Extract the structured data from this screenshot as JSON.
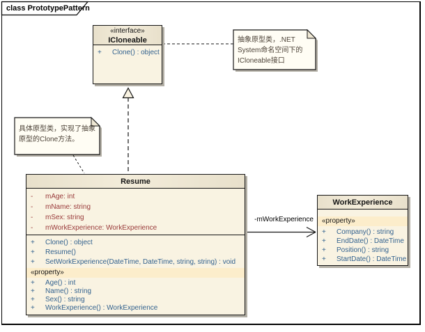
{
  "diagram": {
    "tab_label": "class PrototypePattern"
  },
  "classes": {
    "icloneable": {
      "stereotype": "«interface»",
      "name": "ICloneable",
      "operations": [
        {
          "vis": "+",
          "text": "Clone() : object"
        }
      ]
    },
    "resume": {
      "name": "Resume",
      "attributes": [
        {
          "vis": "-",
          "text": "mAge: int"
        },
        {
          "vis": "-",
          "text": "mName: string"
        },
        {
          "vis": "-",
          "text": "mSex: string"
        },
        {
          "vis": "-",
          "text": "mWorkExperience: WorkExperience"
        }
      ],
      "operations": [
        {
          "vis": "+",
          "text": "Clone() : object"
        },
        {
          "vis": "+",
          "text": "Resume()"
        },
        {
          "vis": "+",
          "text": "SetWorkExperience(DateTime, DateTime, string, string) : void"
        }
      ],
      "property_group_label": "«property»",
      "properties": [
        {
          "vis": "+",
          "text": "Age() : int"
        },
        {
          "vis": "+",
          "text": "Name() : string"
        },
        {
          "vis": "+",
          "text": "Sex() : string"
        },
        {
          "vis": "+",
          "text": "WorkExperience() : WorkExperience"
        }
      ]
    },
    "workexperience": {
      "name": "WorkExperience",
      "property_group_label": "«property»",
      "properties": [
        {
          "vis": "+",
          "text": "Company() : string"
        },
        {
          "vis": "+",
          "text": "EndDate() : DateTime"
        },
        {
          "vis": "+",
          "text": "Position() : string"
        },
        {
          "vis": "+",
          "text": "StartDate() : DateTime"
        }
      ]
    }
  },
  "notes": {
    "abstract_prototype": {
      "line1": "抽象原型类，.NET",
      "line2": "System命名空间下的",
      "line3": "ICloneable接口"
    },
    "concrete_prototype": {
      "line1": "具体原型类，实现了抽象",
      "line2": "原型的Clone方法。"
    }
  },
  "connectors": {
    "association_label": "-mWorkExperience"
  },
  "colors": {
    "class_fill": "#f9f3e2",
    "header_fill": "#e8e0cb",
    "property_row_fill": "#fcedcb",
    "attribute_text": "#993a3a",
    "operation_text": "#33628f",
    "note_fill": "#fffdf4",
    "shadow": "#b3afa5"
  }
}
